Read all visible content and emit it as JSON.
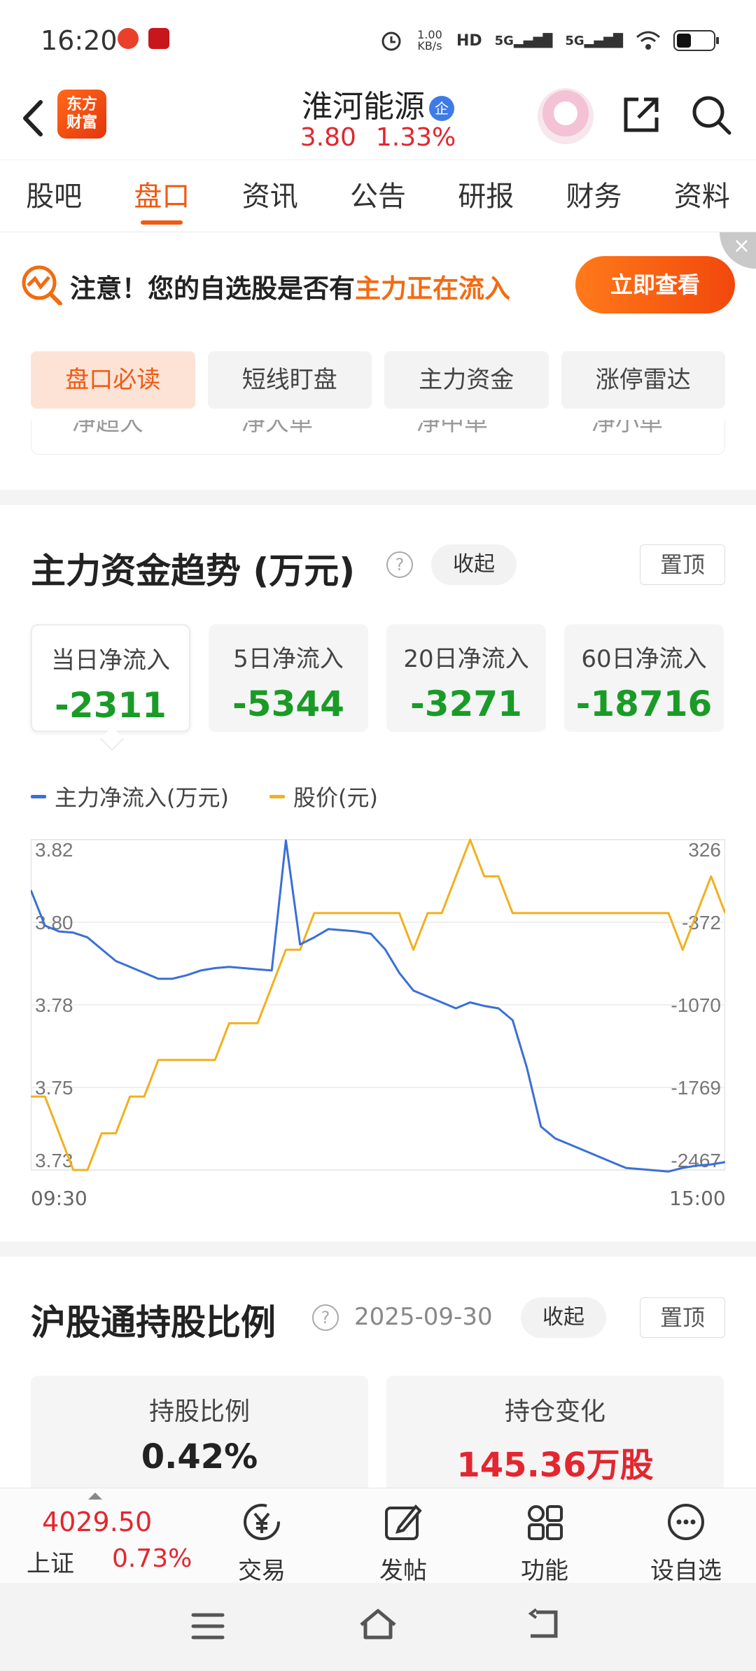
{
  "status_bar": {
    "time": "16:20",
    "net_speed": "1.00 KB/s",
    "hd": "HD",
    "sig1": "5G",
    "sig2": "5G"
  },
  "header": {
    "logo_text_line1": "东方",
    "logo_text_line2": "财富",
    "stock_name": "淮河能源",
    "badge": "企",
    "price": "3.80",
    "change_pct": "1.33%"
  },
  "tabs": [
    "股吧",
    "盘口",
    "资讯",
    "公告",
    "研报",
    "财务",
    "资料"
  ],
  "notice": {
    "text_prefix": "注意！您的自选股是否有",
    "text_highlight": "主力正在流入",
    "button": "立即查看",
    "close": "×"
  },
  "subtabs": [
    "盘口必读",
    "短线盯盘",
    "主力资金",
    "涨停雷达"
  ],
  "cut_labels": [
    "净超大",
    "净大单",
    "净中单",
    "净小单"
  ],
  "main_fund": {
    "title": "主力资金趋势 (万元)",
    "collapse": "收起",
    "pin": "置顶",
    "help": "?",
    "stats": [
      {
        "label": "当日净流入",
        "value": "-2311"
      },
      {
        "label": "5日净流入",
        "value": "-5344"
      },
      {
        "label": "20日净流入",
        "value": "-3271"
      },
      {
        "label": "60日净流入",
        "value": "-18716"
      }
    ]
  },
  "chart_data": {
    "type": "line",
    "series": [
      {
        "name": "主力净流入(万元)",
        "color": "#3a6fd8",
        "axis": "right",
        "values": [
          -100,
          -400,
          -450,
          -460,
          -500,
          -600,
          -700,
          -750,
          -800,
          -850,
          -850,
          -820,
          -780,
          -760,
          -750,
          -760,
          -770,
          -780,
          320,
          -560,
          -500,
          -430,
          -440,
          -450,
          -470,
          -600,
          -800,
          -950,
          -1000,
          -1050,
          -1100,
          -1050,
          -1080,
          -1100,
          -1200,
          -1600,
          -2100,
          -2200,
          -2250,
          -2300,
          -2350,
          -2400,
          -2450,
          -2460,
          -2470,
          -2480,
          -2450,
          -2430,
          -2420,
          -2400
        ]
      },
      {
        "name": "股价(元)",
        "color": "#f2b01e",
        "axis": "left",
        "values": [
          3.75,
          3.75,
          3.74,
          3.73,
          3.73,
          3.74,
          3.74,
          3.75,
          3.75,
          3.76,
          3.76,
          3.76,
          3.76,
          3.76,
          3.77,
          3.77,
          3.77,
          3.78,
          3.79,
          3.79,
          3.8,
          3.8,
          3.8,
          3.8,
          3.8,
          3.8,
          3.8,
          3.79,
          3.8,
          3.8,
          3.81,
          3.82,
          3.81,
          3.81,
          3.8,
          3.8,
          3.8,
          3.8,
          3.8,
          3.8,
          3.8,
          3.8,
          3.8,
          3.8,
          3.8,
          3.8,
          3.79,
          3.8,
          3.81,
          3.8
        ]
      }
    ],
    "left_axis_ticks": [
      "3.82",
      "3.80",
      "3.78",
      "3.75",
      "3.73"
    ],
    "right_axis_ticks": [
      "326",
      "-372",
      "-1070",
      "-1769",
      "-2467"
    ],
    "left_ylim": [
      3.73,
      3.82
    ],
    "right_ylim": [
      -2467,
      326
    ],
    "x_start": "09:30",
    "x_end": "15:00",
    "legend_position": "top-left",
    "grid": true
  },
  "hk_connect": {
    "title": "沪股通持股比例",
    "date": "2025-09-30",
    "collapse": "收起",
    "pin": "置顶",
    "help": "?",
    "cards": [
      {
        "label": "持股比例",
        "value": "0.42%",
        "color": "#222222"
      },
      {
        "label": "持仓变化",
        "value": "145.36万股",
        "color": "#e3262f"
      }
    ]
  },
  "bottom_bar": {
    "index_value": "4029.50",
    "index_name": "上证",
    "index_pct": "0.73%",
    "items": [
      {
        "label": "交易",
        "icon": "yen-circle-icon"
      },
      {
        "label": "发帖",
        "icon": "edit-icon"
      },
      {
        "label": "功能",
        "icon": "grid-icon"
      },
      {
        "label": "设自选",
        "icon": "more-circle-icon"
      }
    ]
  },
  "colors": {
    "accent": "#f05a12",
    "up": "#e3262f",
    "down": "#1a9b27"
  }
}
